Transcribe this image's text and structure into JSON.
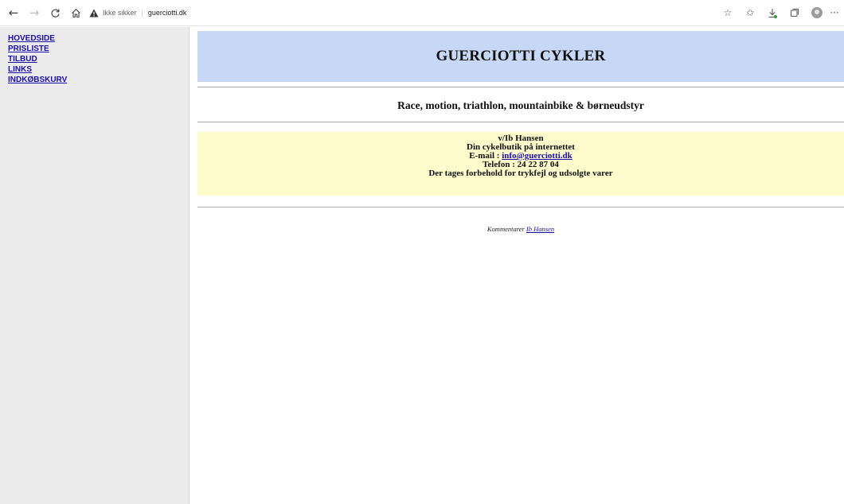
{
  "browser": {
    "back_icon": "arrow-left-icon",
    "forward_icon": "arrow-right-icon",
    "refresh_icon": "refresh-icon",
    "home_icon": "home-icon",
    "security_label": "Ikke sikker",
    "host": "guerciotti.dk",
    "warning_color": "#333333",
    "right_icons": [
      "add-favorite-icon",
      "favorites-icon",
      "downloads-icon",
      "collections-icon",
      "profile-icon",
      "more-icon"
    ]
  },
  "sidebar": {
    "items": [
      {
        "label": "HOVEDSIDE"
      },
      {
        "label": "PRISLISTE"
      },
      {
        "label": "TILBUD"
      },
      {
        "label": "LINKS"
      },
      {
        "label": "INDKØBSKURV"
      }
    ]
  },
  "main": {
    "title": "GUERCIOTTI CYKLER",
    "subtitle": "Race, motion, triathlon, mountainbike & børneudstyr",
    "info": {
      "owner": "v/Ib Hansen",
      "tagline": "Din cykelbutik på internettet",
      "email_label": "E-mail : ",
      "email": "info@guerciotti.dk",
      "phone": "Telefon : 24 22 87 04",
      "disclaimer": "Der tages forbehold for trykfejl og udsolgte varer"
    },
    "footer": {
      "prefix": "Kommentarer ",
      "link": "Ib Hansen"
    }
  },
  "colors": {
    "title_bg": "#c6d8f5",
    "info_bg": "#fdfacc",
    "sidebar_bg": "#ebebeb",
    "link": "#1a0dab"
  }
}
